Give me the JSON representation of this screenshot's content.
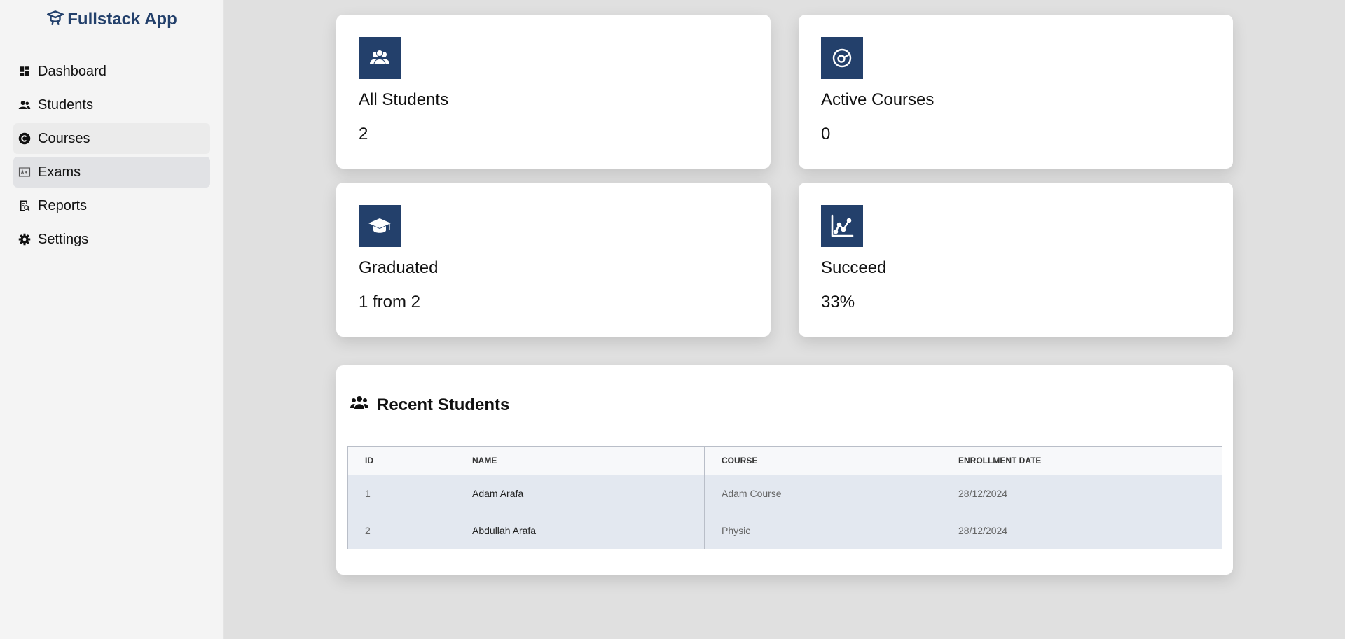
{
  "app": {
    "title": "Fullstack App",
    "brand_icon": "graduate-cap-icon",
    "brand_color": "#23406b"
  },
  "sidebar": {
    "items": [
      {
        "label": "Dashboard",
        "icon": "dashboard-icon",
        "state": "normal"
      },
      {
        "label": "Students",
        "icon": "users-icon",
        "state": "normal"
      },
      {
        "label": "Courses",
        "icon": "copyright-icon",
        "state": "hover"
      },
      {
        "label": "Exams",
        "icon": "exam-icon",
        "state": "active"
      },
      {
        "label": "Reports",
        "icon": "report-search-icon",
        "state": "normal"
      },
      {
        "label": "Settings",
        "icon": "gear-icon",
        "state": "normal"
      }
    ]
  },
  "stats": [
    {
      "title": "All Students",
      "value": "2",
      "icon": "students-group-icon"
    },
    {
      "title": "Active Courses",
      "value": "0",
      "icon": "course-target-icon"
    },
    {
      "title": "Graduated",
      "value": "1 from 2",
      "icon": "graduation-cap-icon"
    },
    {
      "title": "Succeed",
      "value": "33%",
      "icon": "line-chart-icon"
    }
  ],
  "recent": {
    "title": "Recent Students",
    "icon": "users-group-icon",
    "columns": [
      "ID",
      "NAME",
      "COURSE",
      "ENROLLMENT DATE"
    ],
    "rows": [
      {
        "id": "1",
        "name": "Adam Arafa",
        "course": "Adam Course",
        "date": "28/12/2024"
      },
      {
        "id": "2",
        "name": "Abdullah Arafa",
        "course": "Physic",
        "date": "28/12/2024"
      }
    ]
  }
}
